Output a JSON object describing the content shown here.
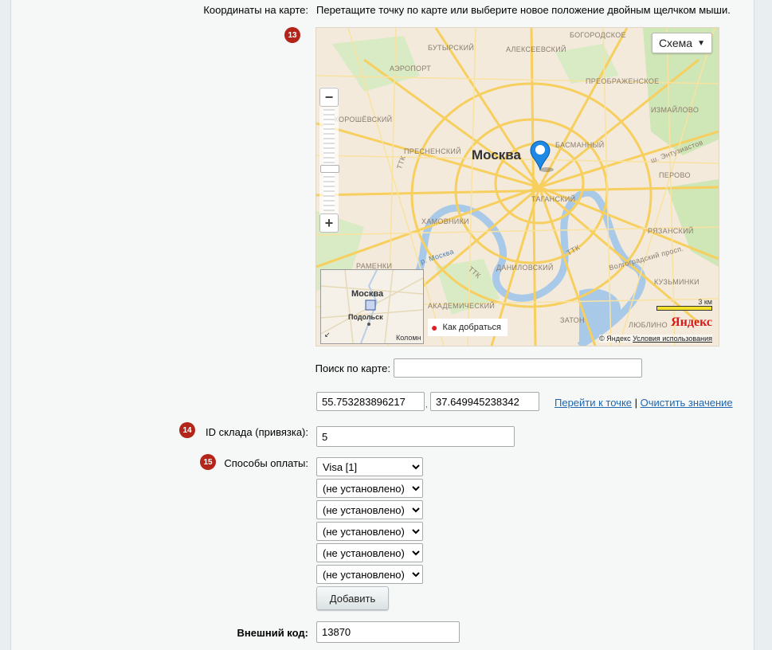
{
  "coords": {
    "label": "Координаты на карте:",
    "hint": "Перетащите точку по карте или выберите новое положение двойным щелчком мыши.",
    "badge": "13"
  },
  "map": {
    "city_label": "Москва",
    "schema_button": "Схема",
    "route_button": "Как добраться",
    "mini_city": "Москва",
    "mini_town": "Подольск",
    "mini_edge": "Коломн",
    "scale_label": "3 км",
    "brand": "Яндекс",
    "copyright": "© Яндекс",
    "terms_link": "Условия использования",
    "districts": [
      "БУТЫРСКИЙ",
      "АЛЕКСЕЕВСКИЙ",
      "БОГОРОДСКОЕ",
      "АЭРОПОРТ",
      "ПРЕОБРАЖЕНСКОЕ",
      "ИЗМАЙЛОВО",
      "ХОРОШЁВСКИЙ",
      "ПРЕСНЕНСКИЙ",
      "БАСМАННЫЙ",
      "ш. Энтузиастов",
      "ПЕРОВО",
      "ХАМОВНИКИ",
      "ТАГАНСКИЙ",
      "РЯЗАНСКИЙ",
      "р. Москва",
      "ДАНИЛОВСКИЙ",
      "Волгоградский просп.",
      "КУЗЬМИНКИ",
      "РАМЕНКИ",
      "АКАДЕМИЧЕСКИЙ",
      "ЗАТОН",
      "ЛЮБЛИНО",
      "ТТК"
    ]
  },
  "search": {
    "label": "Поиск по карте:",
    "value": ""
  },
  "latlng": {
    "lat": "55.753283896217",
    "lng": "37.649945238342",
    "separator": ",",
    "goto_link": "Перейти к точке",
    "divider": "|",
    "clear_link": "Очистить значение"
  },
  "store": {
    "badge": "14",
    "label": "ID склада (привязка):",
    "value": "5"
  },
  "payment": {
    "badge": "15",
    "label": "Способы оплаты:",
    "selects": [
      "Visa [1]",
      "(не установлено)",
      "(не установлено)",
      "(не установлено)",
      "(не установлено)",
      "(не установлено)"
    ],
    "add_button": "Добавить"
  },
  "external": {
    "label": "Внешний код:",
    "value": "13870"
  },
  "colors": {
    "badge": "#b3241b",
    "link": "#2067b0",
    "marker": "#1e88e5"
  }
}
